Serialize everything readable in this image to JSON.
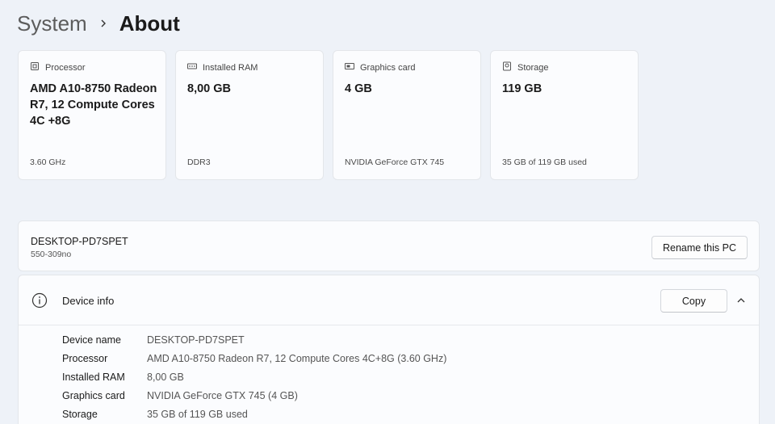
{
  "breadcrumb": {
    "parent": "System",
    "current": "About"
  },
  "cards": [
    {
      "title": "Processor",
      "icon": "processor-icon",
      "value": "AMD A10-8750 Radeon R7, 12 Compute Cores 4C +8G",
      "sub": "3.60 GHz"
    },
    {
      "title": "Installed RAM",
      "icon": "ram-icon",
      "value": "8,00 GB",
      "sub": "DDR3"
    },
    {
      "title": "Graphics card",
      "icon": "graphics-card-icon",
      "value": "4 GB",
      "sub": "NVIDIA GeForce GTX 745"
    },
    {
      "title": "Storage",
      "icon": "storage-icon",
      "value": "119 GB",
      "sub": "35 GB of 119 GB used"
    }
  ],
  "pc": {
    "name": "DESKTOP-PD7SPET",
    "model": "550-309no",
    "rename_label": "Rename this PC"
  },
  "device_info": {
    "title": "Device info",
    "copy_label": "Copy",
    "rows": [
      {
        "label": "Device name",
        "value": "DESKTOP-PD7SPET"
      },
      {
        "label": "Processor",
        "value": "AMD A10-8750 Radeon R7, 12 Compute Cores 4C+8G (3.60 GHz)"
      },
      {
        "label": "Installed RAM",
        "value": "8,00 GB"
      },
      {
        "label": "Graphics card",
        "value": "NVIDIA GeForce GTX 745 (4 GB)"
      },
      {
        "label": "Storage",
        "value": "35 GB of 119 GB used"
      }
    ]
  }
}
